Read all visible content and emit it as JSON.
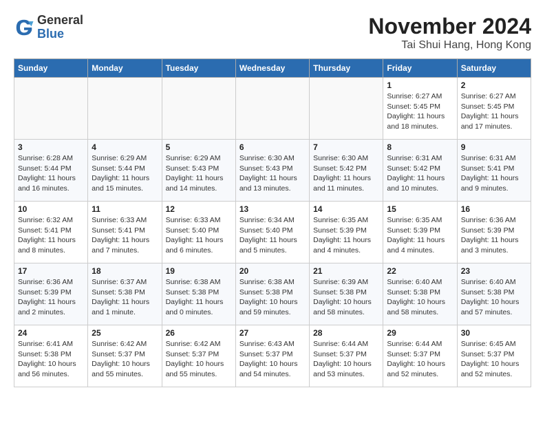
{
  "header": {
    "logo_general": "General",
    "logo_blue": "Blue",
    "month_title": "November 2024",
    "location": "Tai Shui Hang, Hong Kong"
  },
  "days_of_week": [
    "Sunday",
    "Monday",
    "Tuesday",
    "Wednesday",
    "Thursday",
    "Friday",
    "Saturday"
  ],
  "weeks": [
    [
      {
        "day": "",
        "info": ""
      },
      {
        "day": "",
        "info": ""
      },
      {
        "day": "",
        "info": ""
      },
      {
        "day": "",
        "info": ""
      },
      {
        "day": "",
        "info": ""
      },
      {
        "day": "1",
        "info": "Sunrise: 6:27 AM\nSunset: 5:45 PM\nDaylight: 11 hours\nand 18 minutes."
      },
      {
        "day": "2",
        "info": "Sunrise: 6:27 AM\nSunset: 5:45 PM\nDaylight: 11 hours\nand 17 minutes."
      }
    ],
    [
      {
        "day": "3",
        "info": "Sunrise: 6:28 AM\nSunset: 5:44 PM\nDaylight: 11 hours\nand 16 minutes."
      },
      {
        "day": "4",
        "info": "Sunrise: 6:29 AM\nSunset: 5:44 PM\nDaylight: 11 hours\nand 15 minutes."
      },
      {
        "day": "5",
        "info": "Sunrise: 6:29 AM\nSunset: 5:43 PM\nDaylight: 11 hours\nand 14 minutes."
      },
      {
        "day": "6",
        "info": "Sunrise: 6:30 AM\nSunset: 5:43 PM\nDaylight: 11 hours\nand 13 minutes."
      },
      {
        "day": "7",
        "info": "Sunrise: 6:30 AM\nSunset: 5:42 PM\nDaylight: 11 hours\nand 11 minutes."
      },
      {
        "day": "8",
        "info": "Sunrise: 6:31 AM\nSunset: 5:42 PM\nDaylight: 11 hours\nand 10 minutes."
      },
      {
        "day": "9",
        "info": "Sunrise: 6:31 AM\nSunset: 5:41 PM\nDaylight: 11 hours\nand 9 minutes."
      }
    ],
    [
      {
        "day": "10",
        "info": "Sunrise: 6:32 AM\nSunset: 5:41 PM\nDaylight: 11 hours\nand 8 minutes."
      },
      {
        "day": "11",
        "info": "Sunrise: 6:33 AM\nSunset: 5:41 PM\nDaylight: 11 hours\nand 7 minutes."
      },
      {
        "day": "12",
        "info": "Sunrise: 6:33 AM\nSunset: 5:40 PM\nDaylight: 11 hours\nand 6 minutes."
      },
      {
        "day": "13",
        "info": "Sunrise: 6:34 AM\nSunset: 5:40 PM\nDaylight: 11 hours\nand 5 minutes."
      },
      {
        "day": "14",
        "info": "Sunrise: 6:35 AM\nSunset: 5:39 PM\nDaylight: 11 hours\nand 4 minutes."
      },
      {
        "day": "15",
        "info": "Sunrise: 6:35 AM\nSunset: 5:39 PM\nDaylight: 11 hours\nand 4 minutes."
      },
      {
        "day": "16",
        "info": "Sunrise: 6:36 AM\nSunset: 5:39 PM\nDaylight: 11 hours\nand 3 minutes."
      }
    ],
    [
      {
        "day": "17",
        "info": "Sunrise: 6:36 AM\nSunset: 5:39 PM\nDaylight: 11 hours\nand 2 minutes."
      },
      {
        "day": "18",
        "info": "Sunrise: 6:37 AM\nSunset: 5:38 PM\nDaylight: 11 hours\nand 1 minute."
      },
      {
        "day": "19",
        "info": "Sunrise: 6:38 AM\nSunset: 5:38 PM\nDaylight: 11 hours\nand 0 minutes."
      },
      {
        "day": "20",
        "info": "Sunrise: 6:38 AM\nSunset: 5:38 PM\nDaylight: 10 hours\nand 59 minutes."
      },
      {
        "day": "21",
        "info": "Sunrise: 6:39 AM\nSunset: 5:38 PM\nDaylight: 10 hours\nand 58 minutes."
      },
      {
        "day": "22",
        "info": "Sunrise: 6:40 AM\nSunset: 5:38 PM\nDaylight: 10 hours\nand 58 minutes."
      },
      {
        "day": "23",
        "info": "Sunrise: 6:40 AM\nSunset: 5:38 PM\nDaylight: 10 hours\nand 57 minutes."
      }
    ],
    [
      {
        "day": "24",
        "info": "Sunrise: 6:41 AM\nSunset: 5:38 PM\nDaylight: 10 hours\nand 56 minutes."
      },
      {
        "day": "25",
        "info": "Sunrise: 6:42 AM\nSunset: 5:37 PM\nDaylight: 10 hours\nand 55 minutes."
      },
      {
        "day": "26",
        "info": "Sunrise: 6:42 AM\nSunset: 5:37 PM\nDaylight: 10 hours\nand 55 minutes."
      },
      {
        "day": "27",
        "info": "Sunrise: 6:43 AM\nSunset: 5:37 PM\nDaylight: 10 hours\nand 54 minutes."
      },
      {
        "day": "28",
        "info": "Sunrise: 6:44 AM\nSunset: 5:37 PM\nDaylight: 10 hours\nand 53 minutes."
      },
      {
        "day": "29",
        "info": "Sunrise: 6:44 AM\nSunset: 5:37 PM\nDaylight: 10 hours\nand 52 minutes."
      },
      {
        "day": "30",
        "info": "Sunrise: 6:45 AM\nSunset: 5:37 PM\nDaylight: 10 hours\nand 52 minutes."
      }
    ]
  ]
}
